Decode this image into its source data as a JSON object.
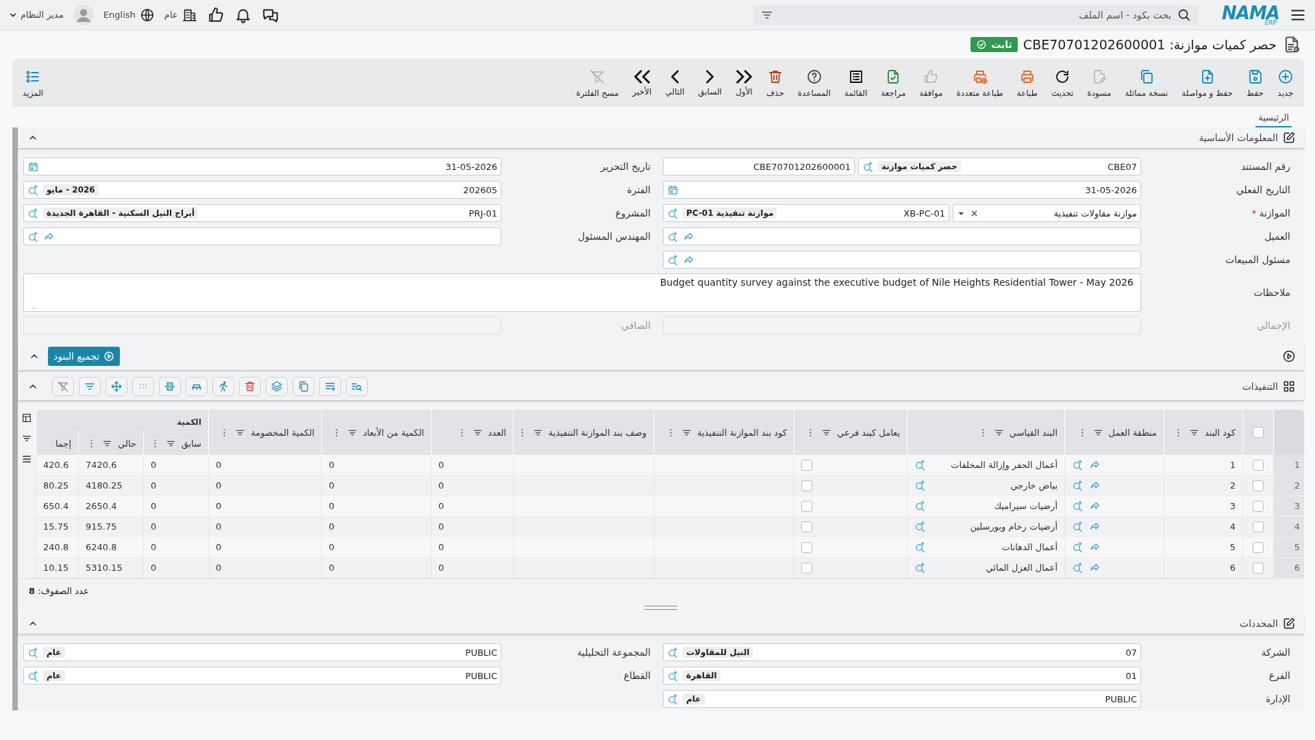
{
  "topbar": {
    "logo": "NAMA",
    "logo_sub": "ERP",
    "search": {
      "placeholder": "بحث بكود - اسم الملف"
    },
    "company": "عام",
    "language": "English",
    "user": "مدير النظام"
  },
  "title": {
    "text": "حصر كميات موازنة: CBE70701202600001",
    "status": "ثابت"
  },
  "toolbar": [
    {
      "kind": "new",
      "label": "جديد",
      "disabled": false
    },
    {
      "kind": "save",
      "label": "حفظ",
      "disabled": false
    },
    {
      "kind": "save_continue",
      "label": "حفظ و مواصلة",
      "disabled": false
    },
    {
      "kind": "duplicate",
      "label": "نسخة مماثلة",
      "disabled": false
    },
    {
      "kind": "draft",
      "label": "مسودة",
      "disabled": true
    },
    {
      "kind": "refresh",
      "label": "تحديث",
      "disabled": false
    },
    {
      "kind": "print",
      "label": "طباعة",
      "disabled": false
    },
    {
      "kind": "multi_print",
      "label": "طباعة متعددة",
      "disabled": false
    },
    {
      "kind": "approve",
      "label": "موافقة",
      "disabled": true
    },
    {
      "kind": "review",
      "label": "مراجعة",
      "disabled": false
    },
    {
      "kind": "list",
      "label": "القائمة",
      "disabled": false
    },
    {
      "kind": "help",
      "label": "المساعدة",
      "disabled": false
    },
    {
      "kind": "delete",
      "label": "حذف",
      "disabled": false
    },
    {
      "kind": "first",
      "label": "الأول",
      "disabled": false
    },
    {
      "kind": "previous",
      "label": "السابق",
      "disabled": false
    },
    {
      "kind": "next",
      "label": "التالي",
      "disabled": false
    },
    {
      "kind": "last",
      "label": "الأخير",
      "disabled": false
    },
    {
      "kind": "clear_filter",
      "label": "مسح الفلترة",
      "disabled": true
    }
  ],
  "more": "المزيد",
  "tabs": [
    {
      "label": "الرئيسية",
      "selected": true
    }
  ],
  "basic_info": {
    "title": "المعلومات الأساسية",
    "expanded": true,
    "right": [
      {
        "label": "رقم المستند",
        "parts": [
          {
            "kind": "lookup",
            "value": "CBE07",
            "chip": "حصر كميات موازنة",
            "link": false
          },
          {
            "kind": "text",
            "value": "CBE70701202600001"
          }
        ]
      },
      {
        "label": "التاريخ الفعلي",
        "parts": [
          {
            "kind": "date",
            "value": "31-05-2026"
          }
        ]
      },
      {
        "label": "الموازنة",
        "mark": "*",
        "parts": [
          {
            "kind": "select",
            "value": "موازنة مقاولات تنفيذية"
          },
          {
            "kind": "lookup",
            "value": "XB-PC-01",
            "chip": "موازنة تنفيذية PC-01",
            "link": false
          }
        ]
      },
      {
        "label": "العميل",
        "parts": [
          {
            "kind": "lookup",
            "link": true
          }
        ]
      },
      {
        "label": "مسئول المبيعات",
        "parts": [
          {
            "kind": "lookup",
            "link": true
          }
        ]
      }
    ],
    "left": [
      {
        "label": "تاريخ التحرير",
        "parts": [
          {
            "kind": "date",
            "value": "31-05-2026"
          }
        ]
      },
      {
        "label": "الفترة",
        "parts": [
          {
            "kind": "lookup",
            "value": "202605",
            "chip": "2026 - مايو",
            "link": false
          }
        ]
      },
      {
        "label": "المشروع",
        "parts": [
          {
            "kind": "lookup",
            "value": "PRJ-01",
            "chip": "أبراج النيل السكنية - القاهرة الجديدة",
            "link": false
          }
        ]
      },
      {
        "label": "المهندس المسئول",
        "parts": [
          {
            "kind": "lookup",
            "link": true
          }
        ]
      }
    ],
    "notes": {
      "label": "ملاحظات",
      "value": "Budget quantity survey against the executive budget of Nile Heights Residential Tower - May 2026"
    },
    "totals": [
      {
        "label": "الإجمالي",
        "parts": [
          {
            "kind": "text",
            "disabled": true
          }
        ]
      },
      {
        "label": "الصافي",
        "parts": [
          {
            "kind": "text",
            "disabled": true
          }
        ]
      }
    ]
  },
  "group_action": {
    "label": "تجميع البنود",
    "expanded": true
  },
  "grid": {
    "title": "التنفيذات",
    "expanded": true,
    "all_checked": false,
    "columns": [
      {
        "label": "كود البند",
        "tools": true
      },
      {
        "label": "منطقة العمل",
        "tools": true
      },
      {
        "label": "البند القياسي",
        "tools": true
      },
      {
        "label": "يعامل كبند فرعي",
        "tools": true
      },
      {
        "label": "كود بند الموازنة التنفيذية",
        "tools": true
      },
      {
        "label": "وصف بند الموازنة التنفيذية",
        "tools": true
      },
      {
        "label": "العدد",
        "tools": true
      },
      {
        "label": "الكمية من الأبعاد",
        "tools": true
      },
      {
        "label": "الكمية المخصومة",
        "tools": true
      }
    ],
    "group": {
      "label": "الكمية",
      "columns": [
        {
          "label": "سابق",
          "tools": true
        },
        {
          "label": "حالي",
          "tools": true
        },
        {
          "label": "إجما",
          "tools": false
        }
      ]
    },
    "rows": [
      {
        "number": "1",
        "selected": false,
        "item_code": "1",
        "standard_item": "أعمال الحفر وإزالة المخلفات",
        "sub_item": false,
        "count": "0",
        "dimension_qty": "0",
        "deducted_qty": "0",
        "previous": "0",
        "current": "7420.6",
        "total": "420.6"
      },
      {
        "number": "2",
        "selected": false,
        "item_code": "2",
        "standard_item": "بياض خارجي",
        "sub_item": false,
        "count": "0",
        "dimension_qty": "0",
        "deducted_qty": "0",
        "previous": "0",
        "current": "4180.25",
        "total": "80.25"
      },
      {
        "number": "3",
        "selected": false,
        "item_code": "3",
        "standard_item": "أرضيات سيراميك",
        "sub_item": false,
        "count": "0",
        "dimension_qty": "0",
        "deducted_qty": "0",
        "previous": "0",
        "current": "2650.4",
        "total": "650.4"
      },
      {
        "number": "4",
        "selected": false,
        "item_code": "4",
        "standard_item": "أرضيات رخام وبورسلين",
        "sub_item": false,
        "count": "0",
        "dimension_qty": "0",
        "deducted_qty": "0",
        "previous": "0",
        "current": "915.75",
        "total": "15.75"
      },
      {
        "number": "5",
        "selected": false,
        "item_code": "5",
        "standard_item": "أعمال الدهانات",
        "sub_item": false,
        "count": "0",
        "dimension_qty": "0",
        "deducted_qty": "0",
        "previous": "0",
        "current": "6240.8",
        "total": "240.8"
      },
      {
        "number": "6",
        "selected": false,
        "item_code": "6",
        "standard_item": "أعمال العزل المائي",
        "sub_item": false,
        "count": "0",
        "dimension_qty": "0",
        "deducted_qty": "0",
        "previous": "0",
        "current": "5310.15",
        "total": "10.15"
      }
    ],
    "row_count": "عدد الصفوف: **8**"
  },
  "determinants": {
    "title": "المحددات",
    "expanded": true,
    "right": [
      {
        "label": "الشركة",
        "parts": [
          {
            "kind": "lookup",
            "value": "07",
            "chip": "النيل للمقاولات",
            "link": false
          }
        ]
      },
      {
        "label": "الفرع",
        "parts": [
          {
            "kind": "lookup",
            "value": "01",
            "chip": "القاهرة",
            "link": false
          }
        ]
      },
      {
        "label": "الإدارة",
        "parts": [
          {
            "kind": "lookup",
            "value": "PUBLIC",
            "chip": "عام",
            "link": false
          }
        ]
      }
    ],
    "left": [
      {
        "label": "المجموعة التحليلية",
        "parts": [
          {
            "kind": "lookup",
            "value": "PUBLIC",
            "chip": "عام",
            "link": false
          }
        ]
      },
      {
        "label": "القطاع",
        "parts": [
          {
            "kind": "lookup",
            "value": "PUBLIC",
            "chip": "عام",
            "link": false
          }
        ]
      }
    ]
  }
}
